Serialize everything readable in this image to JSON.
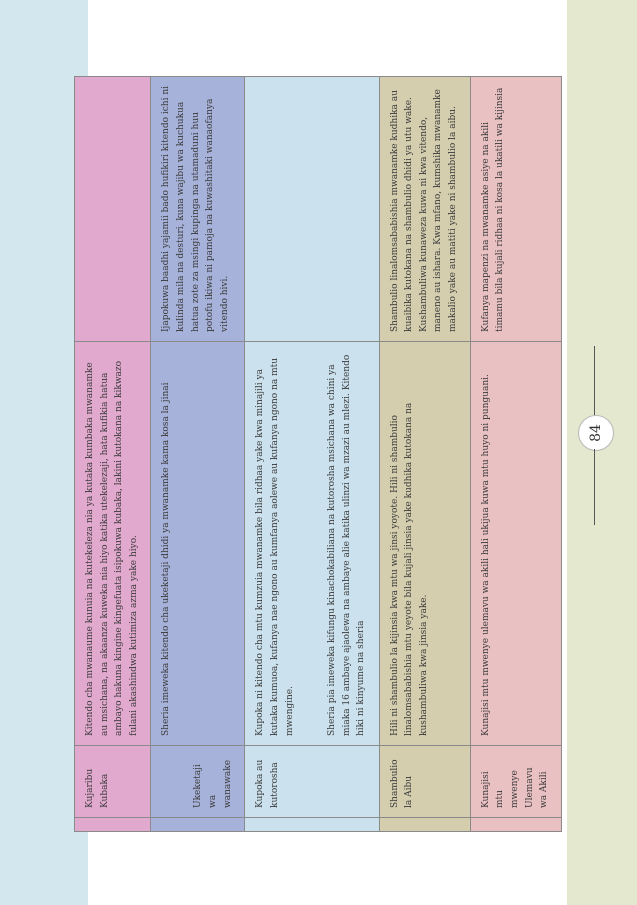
{
  "page_number": "84",
  "rows": [
    {
      "num": "",
      "name": "Kujaribu Kubaka",
      "description": [
        "Kitendo cha mwanaume kunuia na kutekeleza nia ya kutaka kumbaka mwanamke au msichana, na akaanza kuweka nia hiyo katika utekelezaji, hata kufikia hatua ambayo hakuna kingine kingefuata isipokuwa kubaka, lakini kutokana na kikwazo fulani akashindwa kutimiza azma yake hiyo."
      ],
      "notes": ""
    },
    {
      "num": "",
      "name": "Ukeketaji wa wanawake",
      "description": [
        "Sheria imeweka kitendo cha ukeketaji dhidi ya mwanamke kama kosa la jinai"
      ],
      "notes": "Ijapokuwa baadhi yajamii bado hufikiri kitendo ichi ni kulinda mila na desturi, kuna wajibu wa kuchukua hatua zote za msingi kupinga na utamaduni huu potofu ikiwa ni pamoja na kuwashitaki wanaofanya vitendo hivi."
    },
    {
      "num": "",
      "name": "Kupoka au kutorosha",
      "description": [
        "Kupoka ni kitendo cha mtu kumzuia mwanamke bila ridhaa yake kwa minajili ya kutaka kumuoa, kufanya nae ngono au kumfanya aolewe au kufanya ngono na mtu mwengine.",
        "Sheria pia imeweka kifungu kinachokabiliana na kutorosha msichana wa chini ya miaka 16 ambaye ajaolewa na ambaye alie katika ulinzi wa mzazi au mlezi. Kitendo hiki ni kinyume na sheria"
      ],
      "notes": ""
    },
    {
      "num": "",
      "name": "Shambulio la Aibu",
      "description": [
        "Hili ni shambulio la kijinsia kwa mtu wa jinsi yoyote. Hili ni shambulio linalomsababishia mtu yeyote bila kujali jinsia yake kudhika kutokana na kushambuliwa kwa jinsia yake."
      ],
      "notes": "Shambulio linalomsababishia mwanamke kudhika au kuaibika kutokana na shambulio dhidi ya utu wake. Kushambuliwa kunaweza kuwa ni kwa vitendo, maneno au ishara.  Kwa mfano, kumshika mwanamke makalio yake au matiti yake ni shambulio la aibu."
    },
    {
      "num": "",
      "name": "Kunajisi mtu mwenye Ulemavu wa Akili",
      "description": [
        "Kunajisi mtu mwenye ulemavu wa akili hali ukijua kuwa mtu huyo ni punguani."
      ],
      "notes": "Kufanya mapenzi na mwanamke asiye na akili timamu bila kujali ridhaa ni kosa la ukatili wa kijinsia"
    }
  ]
}
